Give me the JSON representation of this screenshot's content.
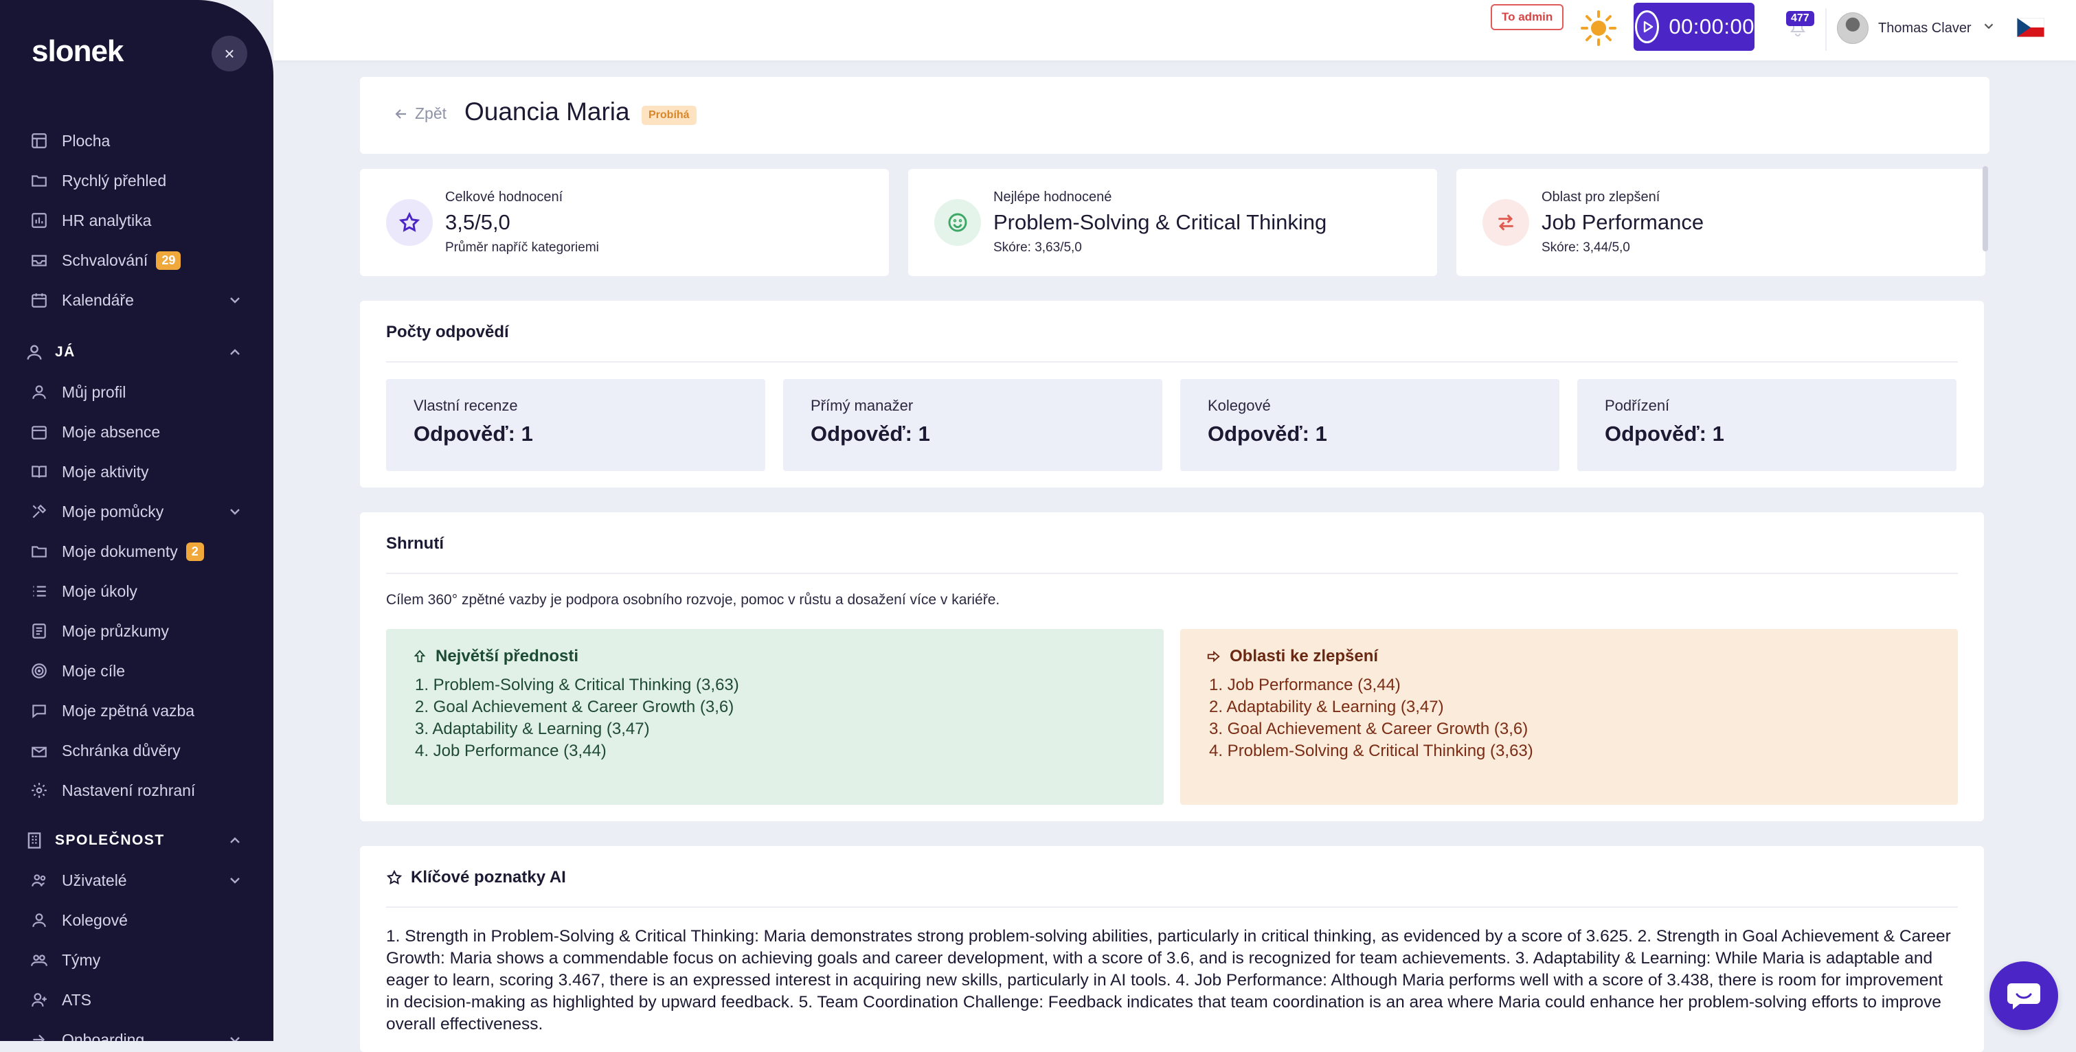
{
  "brand": {
    "logo_text": "slonek"
  },
  "sidebar": {
    "items": [
      {
        "label": "Plocha",
        "icon": "layout-icon"
      },
      {
        "label": "Rychlý přehled",
        "icon": "folder-icon"
      },
      {
        "label": "HR analytika",
        "icon": "chart-icon"
      },
      {
        "label": "Schvalování",
        "icon": "inbox-icon",
        "badge": "29"
      },
      {
        "label": "Kalendáře",
        "icon": "calendar-icon"
      }
    ],
    "section_me": "JÁ",
    "me_items": [
      {
        "label": "Můj profil"
      },
      {
        "label": "Moje absence"
      },
      {
        "label": "Moje aktivity"
      },
      {
        "label": "Moje pomůcky"
      },
      {
        "label": "Moje dokumenty",
        "badge": "2"
      },
      {
        "label": "Moje úkoly"
      },
      {
        "label": "Moje průzkumy"
      },
      {
        "label": "Moje cíle"
      },
      {
        "label": "Moje zpětná vazba"
      },
      {
        "label": "Schránka důvěry"
      },
      {
        "label": "Nastavení rozhraní"
      }
    ],
    "section_company": "SPOLEČNOST",
    "company_items": [
      {
        "label": "Uživatelé"
      },
      {
        "label": "Kolegové"
      },
      {
        "label": "Týmy"
      },
      {
        "label": "ATS"
      },
      {
        "label": "Onboarding"
      }
    ]
  },
  "topbar": {
    "to_admin": "To admin",
    "timer": "00:00:00",
    "notifications": "477",
    "user_name": "Thomas Claver"
  },
  "header": {
    "back": "Zpět",
    "name": "Ouancia Maria",
    "status": "Probíhá"
  },
  "stats": [
    {
      "label": "Celkové hodnocení",
      "value": "3,5/5,0",
      "sub": "Průměr napříč kategoriemi",
      "icon": "star-icon"
    },
    {
      "label": "Nejlépe hodnocené",
      "value": "Problem-Solving & Critical Thinking",
      "sub": "Skóre: 3,63/5,0",
      "icon": "smile-icon"
    },
    {
      "label": "Oblast pro zlepšení",
      "value": "Job Performance",
      "sub": "Skóre: 3,44/5,0",
      "icon": "arrows-icon"
    }
  ],
  "responses": {
    "title": "Počty odpovědí",
    "boxes": [
      {
        "label": "Vlastní recenze",
        "value": "Odpověď: 1"
      },
      {
        "label": "Přímý manažer",
        "value": "Odpověď: 1"
      },
      {
        "label": "Kolegové",
        "value": "Odpověď: 1"
      },
      {
        "label": "Podřízení",
        "value": "Odpověď: 1"
      }
    ]
  },
  "summary": {
    "title": "Shrnutí",
    "intro": "Cílem 360° zpětné vazby je podpora osobního rozvoje, pomoc v růstu a dosažení více v kariéře.",
    "strengths_title": "Největší přednosti",
    "strengths": [
      "1. Problem-Solving & Critical Thinking (3,63)",
      "2. Goal Achievement & Career Growth (3,6)",
      "3. Adaptability & Learning (3,47)",
      "4. Job Performance (3,44)"
    ],
    "improve_title": "Oblasti ke zlepšení",
    "improve": [
      "1. Job Performance (3,44)",
      "2. Adaptability & Learning (3,47)",
      "3. Goal Achievement & Career Growth (3,6)",
      "4. Problem-Solving & Critical Thinking (3,63)"
    ]
  },
  "ai": {
    "title": "Klíčové poznatky AI",
    "text": "1. Strength in Problem-Solving & Critical Thinking: Maria demonstrates strong problem-solving abilities, particularly in critical thinking, as evidenced by a score of 3.625. 2. Strength in Goal Achievement & Career Growth: Maria shows a commendable focus on achieving goals and career development, with a score of 3.6, and is recognized for team achievements. 3. Adaptability & Learning: While Maria is adaptable and eager to learn, scoring 3.467, there is an expressed interest in acquiring new skills, particularly in AI tools. 4. Job Performance: Although Maria performs well with a score of 3.438, there is room for improvement in decision-making as highlighted by upward feedback. 5. Team Coordination Challenge: Feedback indicates that team coordination is an area where Maria could enhance her problem-solving efforts to improve overall effectiveness."
  },
  "colors": {
    "accent": "#4b25c5",
    "sidebar": "#171434",
    "orange": "#f0a83a"
  }
}
